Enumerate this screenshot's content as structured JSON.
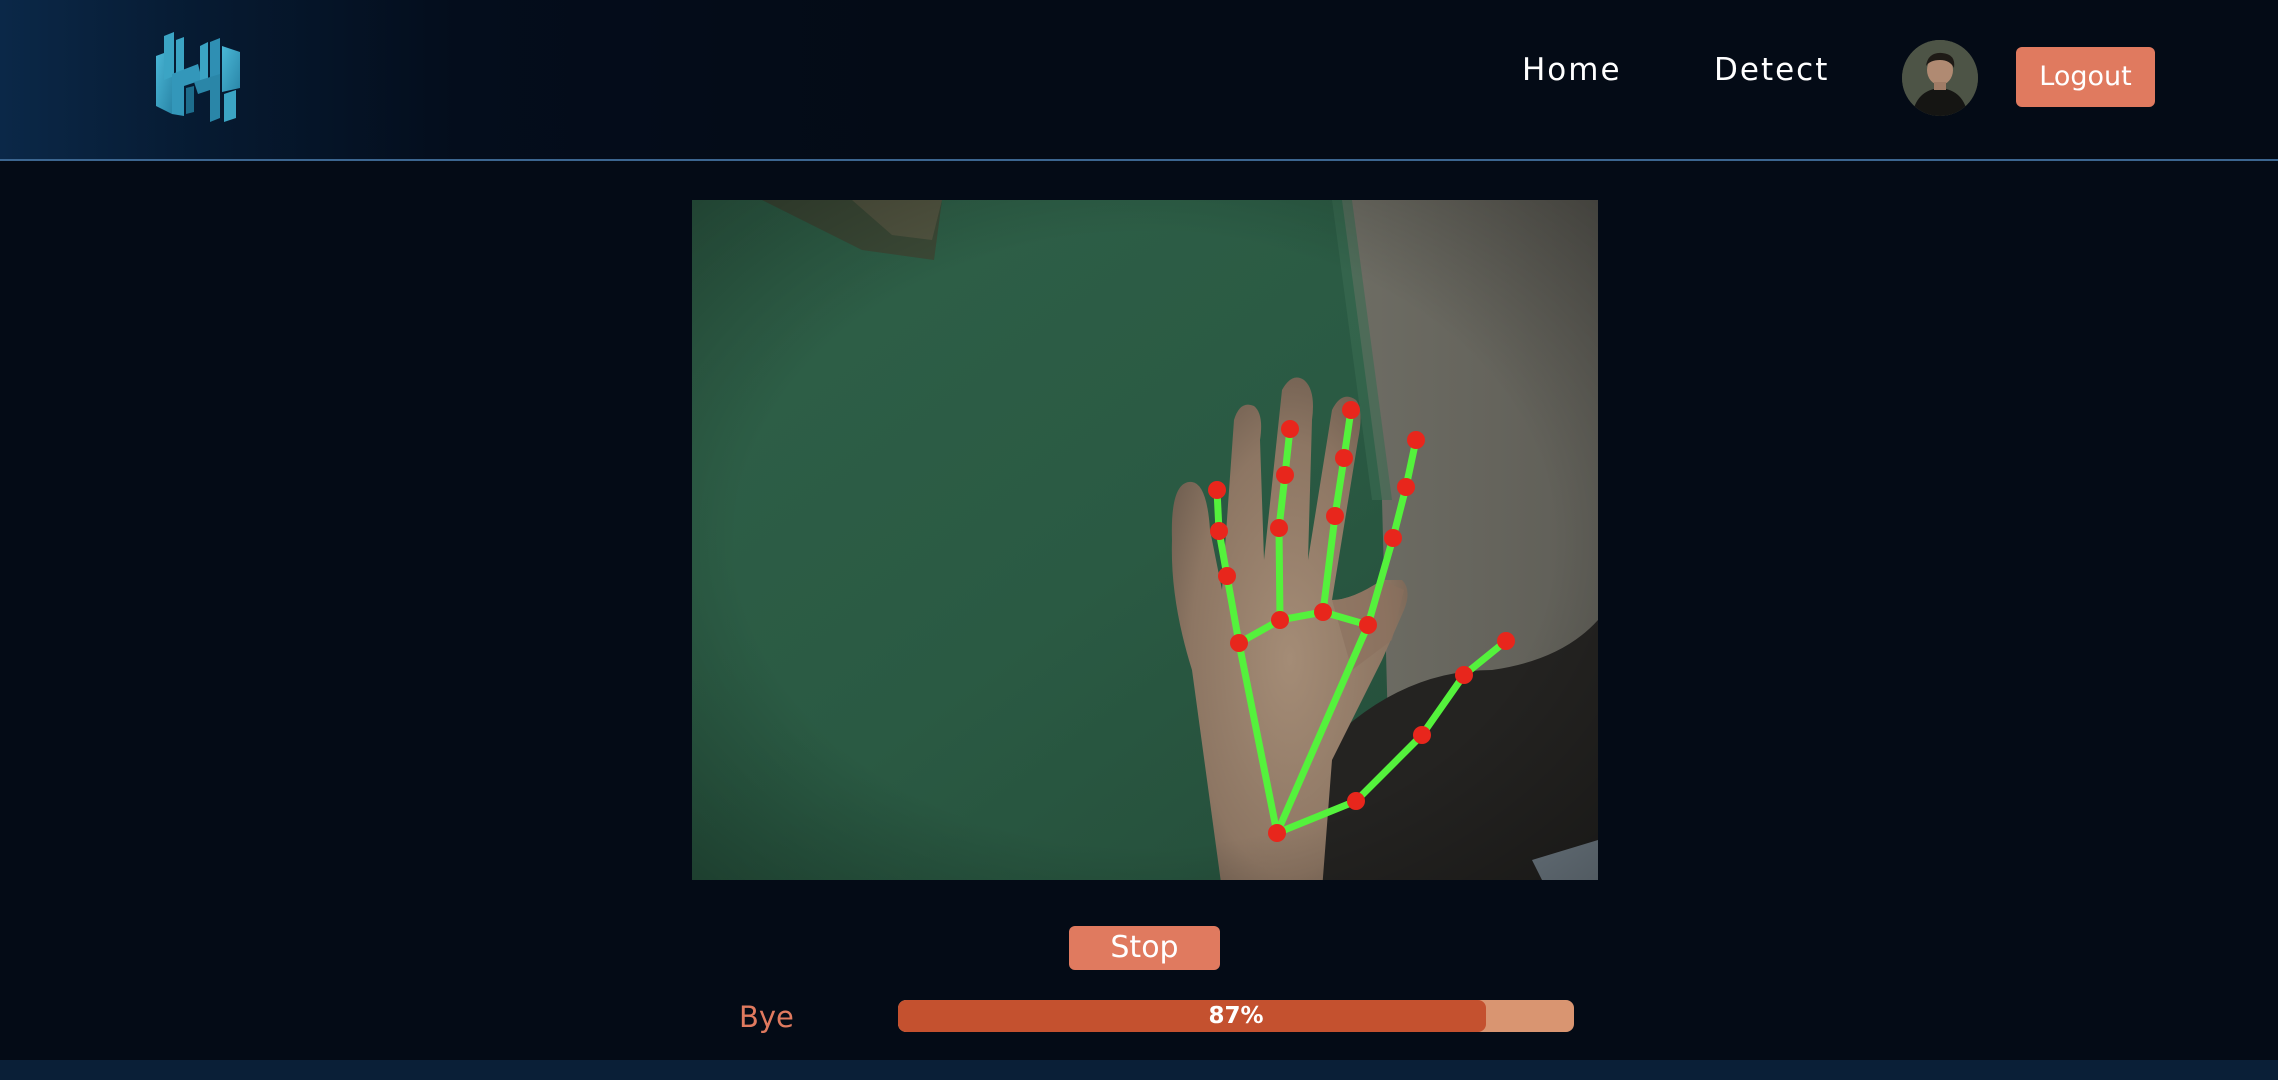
{
  "header": {
    "logo_icon": "hand-sign-logo-icon",
    "nav": [
      {
        "label": "Home"
      },
      {
        "label": "Detect"
      }
    ],
    "avatar_icon": "user-avatar",
    "logout_label": "Logout"
  },
  "detector": {
    "feed_icon": "webcam-feed-with-hand-landmarks",
    "stop_label": "Stop",
    "prediction": "Bye",
    "confidence": 0.87,
    "confidence_text": "87%"
  },
  "colors": {
    "accent": "#e07a5f",
    "progress_fill": "#c4512f",
    "progress_track": "#d99571",
    "landmark_point": "#e8261c",
    "landmark_line": "#54f23c",
    "background": "#040b16",
    "logo": "#3ba4c4"
  }
}
